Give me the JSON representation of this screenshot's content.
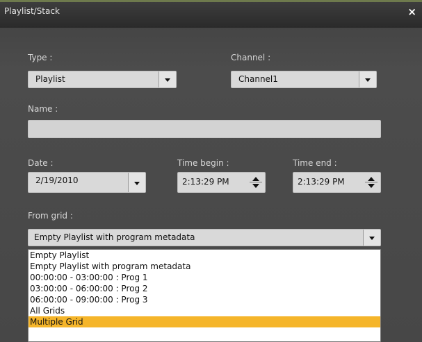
{
  "window": {
    "title": "Playlist/Stack",
    "close_glyph": "×"
  },
  "form": {
    "type": {
      "label": "Type :",
      "value": "Playlist"
    },
    "channel": {
      "label": "Channel :",
      "value": "Channel1"
    },
    "name": {
      "label": "Name :",
      "value": ""
    },
    "date": {
      "label": "Date :",
      "value": "2/19/2010"
    },
    "time_begin": {
      "label": "Time begin :",
      "value": "2:13:29 PM"
    },
    "time_end": {
      "label": "Time end :",
      "value": "2:13:29 PM"
    },
    "from_grid": {
      "label": "From grid :",
      "value": "Empty Playlist with program metadata",
      "options": [
        "Empty Playlist",
        "Empty Playlist with program metadata",
        "00:00:00 - 03:00:00 : Prog 1",
        "03:00:00 - 06:00:00 : Prog 2",
        "06:00:00 - 09:00:00 : Prog 3",
        "All Grids",
        "Multiple Grid"
      ],
      "highlighted_index": 6
    }
  },
  "colors": {
    "highlight": "#f5b52a",
    "panel": "#4a4a4a"
  }
}
